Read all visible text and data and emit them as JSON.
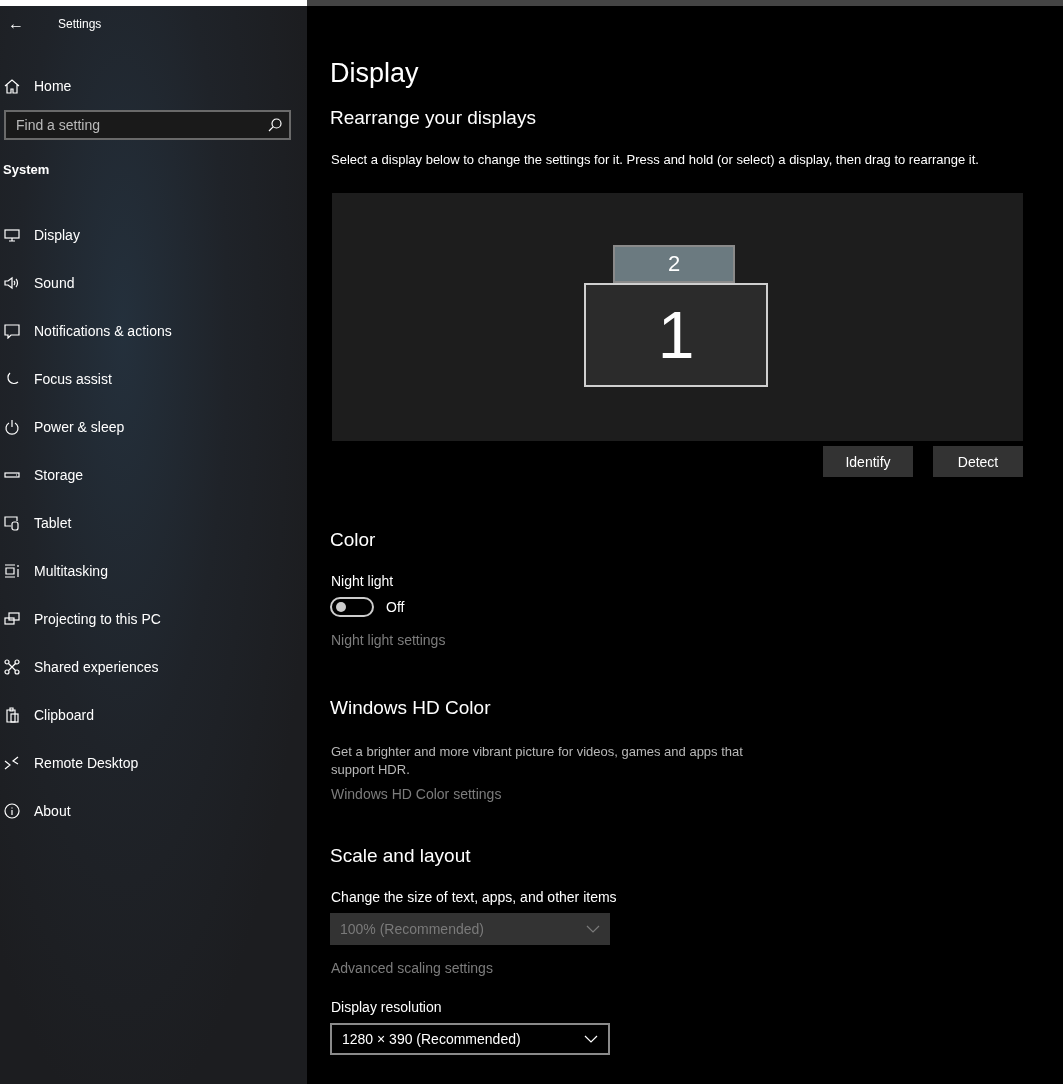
{
  "window": {
    "title": "Settings",
    "back": "←"
  },
  "sidebar": {
    "home": "Home",
    "search": {
      "placeholder": "Find a setting"
    },
    "section": "System",
    "items": [
      {
        "label": "Display"
      },
      {
        "label": "Sound"
      },
      {
        "label": "Notifications & actions"
      },
      {
        "label": "Focus assist"
      },
      {
        "label": "Power & sleep"
      },
      {
        "label": "Storage"
      },
      {
        "label": "Tablet"
      },
      {
        "label": "Multitasking"
      },
      {
        "label": "Projecting to this PC"
      },
      {
        "label": "Shared experiences"
      },
      {
        "label": "Clipboard"
      },
      {
        "label": "Remote Desktop"
      },
      {
        "label": "About"
      }
    ]
  },
  "page": {
    "title": "Display",
    "rearrange": {
      "heading": "Rearrange your displays",
      "description": "Select a display below to change the settings for it. Press and hold (or select) a display, then drag to rearrange it.",
      "monitors": [
        {
          "label": "2"
        },
        {
          "label": "1"
        }
      ],
      "buttons": [
        "Identify",
        "Detect"
      ]
    },
    "color": {
      "heading": "Color",
      "night_light": {
        "label": "Night light",
        "on": false,
        "state_text": "Off"
      },
      "link": "Night light settings"
    },
    "hd_color": {
      "heading": "Windows HD Color",
      "description": "Get a brighter and more vibrant picture for videos, games and apps that support HDR.",
      "link": "Windows HD Color settings"
    },
    "scale": {
      "heading": "Scale and layout",
      "size_label": "Change the size of text, apps, and other items",
      "size_value": "100% (Recommended)",
      "size_disabled": true,
      "link": "Advanced scaling settings",
      "resolution_label": "Display resolution",
      "resolution_value": "1280 × 390 (Recommended)",
      "resolution_disabled": false
    }
  }
}
